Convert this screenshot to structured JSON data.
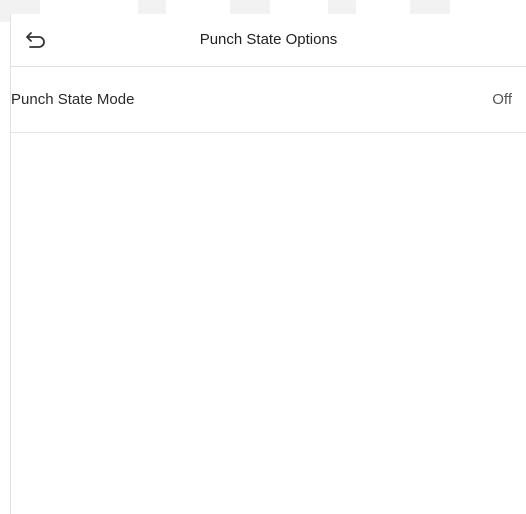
{
  "header": {
    "title": "Punch State Options",
    "back_icon": "back-arrow-icon"
  },
  "settings": {
    "items": [
      {
        "label": "Punch State Mode",
        "value": "Off"
      }
    ]
  }
}
